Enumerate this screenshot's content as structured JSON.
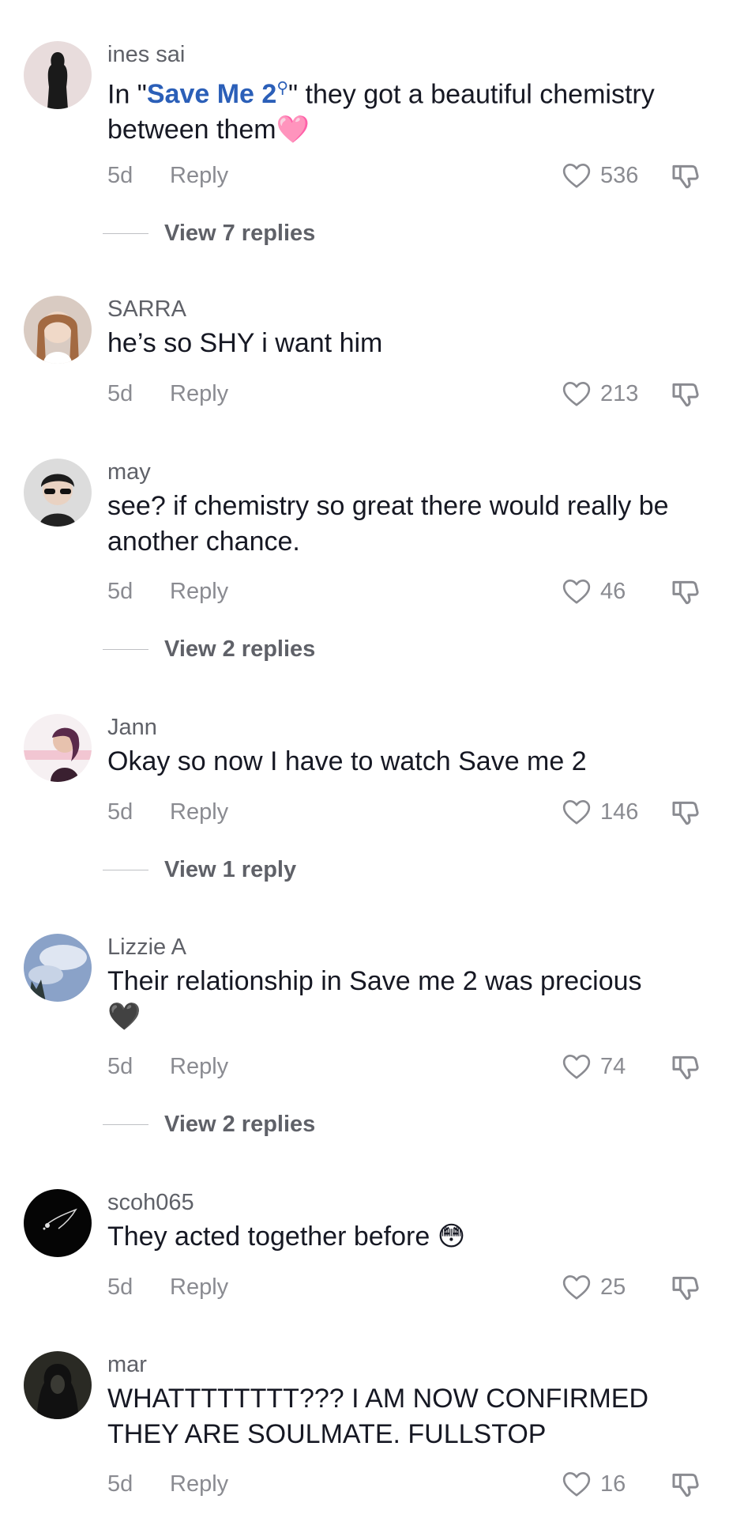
{
  "comments": [
    {
      "username": "ines sai",
      "text_pre": "In \"",
      "text_link": "Save Me 2",
      "text_post": "\" they got a beautiful chemistry between them",
      "emoji": "🩷",
      "date": "5d",
      "reply_label": "Reply",
      "likes": "536",
      "view_replies": "View 7 replies"
    },
    {
      "username": "SARRA",
      "text": "he’s so SHY i want him",
      "date": "5d",
      "reply_label": "Reply",
      "likes": "213"
    },
    {
      "username": "may",
      "text": "see? if chemistry so great there would really be another chance.",
      "date": "5d",
      "reply_label": "Reply",
      "likes": "46",
      "view_replies": "View 2 replies"
    },
    {
      "username": "Jann",
      "text": "Okay so now I have to watch Save me 2",
      "date": "5d",
      "reply_label": "Reply",
      "likes": "146",
      "view_replies": "View 1 reply"
    },
    {
      "username": "Lizzie A",
      "text": "Their relationship in Save me 2 was precious",
      "emoji": "🖤",
      "date": "5d",
      "reply_label": "Reply",
      "likes": "74",
      "view_replies": "View 2 replies"
    },
    {
      "username": "scoh065",
      "text": "They acted together before",
      "emoji": "😳",
      "date": "5d",
      "reply_label": "Reply",
      "likes": "25"
    },
    {
      "username": "mar",
      "text": "WHATTTTTTTT??? I AM NOW CONFIRMED THEY ARE SOULMATE. FULLSTOP",
      "date": "5d",
      "reply_label": "Reply",
      "likes": "16"
    }
  ],
  "colors": {
    "text": "#161823",
    "secondary": "#8a8b91",
    "link": "#2b5fb8"
  },
  "icons": {
    "like": "heart-outline-icon",
    "dislike": "thumbs-down-outline-icon",
    "search_tag": "search-icon"
  }
}
